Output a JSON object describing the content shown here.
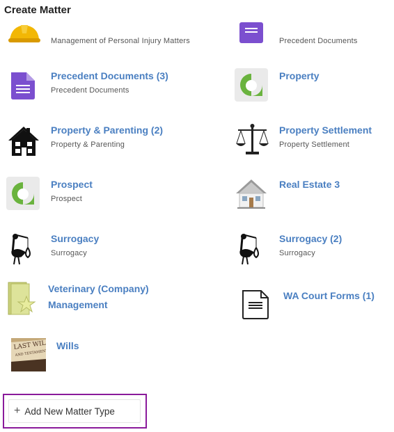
{
  "header": {
    "title": "Create Matter"
  },
  "items": [
    {
      "title": "",
      "subtitle": "Management of Personal Injury Matters",
      "icon": "hard-hat-icon"
    },
    {
      "title": "",
      "subtitle": "Precedent Documents",
      "icon": "document-icon"
    },
    {
      "title": "Precedent Documents (3)",
      "subtitle": "Precedent Documents",
      "icon": "document-icon"
    },
    {
      "title": "Property",
      "subtitle": "",
      "icon": "property-logo-icon"
    },
    {
      "title": "Property & Parenting (2)",
      "subtitle": "Property & Parenting",
      "icon": "house-icon"
    },
    {
      "title": "Property Settlement",
      "subtitle": "Property Settlement",
      "icon": "scales-icon"
    },
    {
      "title": "Prospect",
      "subtitle": "Prospect",
      "icon": "property-logo-icon"
    },
    {
      "title": "Real Estate 3",
      "subtitle": "",
      "icon": "real-estate-house-icon"
    },
    {
      "title": "Surrogacy",
      "subtitle": "Surrogacy",
      "icon": "stork-icon"
    },
    {
      "title": "Surrogacy (2)",
      "subtitle": "Surrogacy",
      "icon": "stork-icon"
    },
    {
      "title_line1": "Veterinary (Company)",
      "title_line2": "Management",
      "icon": "folder-star-icon"
    },
    {
      "title": "WA Court Forms (1)",
      "icon": "form-document-icon"
    },
    {
      "title": "Wills",
      "icon": "will-document-icon"
    }
  ],
  "add_button": {
    "label": "Add New Matter Type",
    "icon": "plus-icon"
  },
  "colors": {
    "link": "#4a7fc1",
    "highlight_border": "#8a1a9b",
    "doc_purple": "#7b4fcf",
    "logo_green": "#6ab33e"
  }
}
